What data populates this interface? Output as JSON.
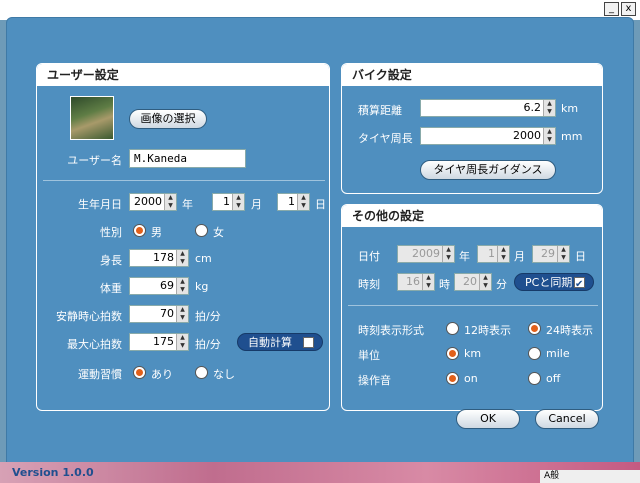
{
  "window": {
    "minimize": "_",
    "close": "x"
  },
  "user_panel": {
    "title": "ユーザー設定",
    "select_image_button": "画像の選択",
    "username_label": "ユーザー名",
    "username_value": "M.Kaneda",
    "birth_label": "生年月日",
    "birth_year": "2000",
    "birth_year_unit": "年",
    "birth_month": "1",
    "birth_month_unit": "月",
    "birth_day": "1",
    "birth_day_unit": "日",
    "gender_label": "性別",
    "gender_male": "男",
    "gender_female": "女",
    "height_label": "身長",
    "height_value": "178",
    "height_unit": "cm",
    "weight_label": "体重",
    "weight_value": "69",
    "weight_unit": "kg",
    "resting_hr_label": "安静時心拍数",
    "resting_hr_value": "70",
    "resting_hr_unit": "拍/分",
    "max_hr_label": "最大心拍数",
    "max_hr_value": "175",
    "max_hr_unit": "拍/分",
    "auto_calc": "自動計算",
    "exercise_label": "運動習慣",
    "exercise_yes": "あり",
    "exercise_no": "なし"
  },
  "bike_panel": {
    "title": "バイク設定",
    "odometer_label": "積算距離",
    "odometer_value": "6.2",
    "odometer_unit": "km",
    "tire_label": "タイヤ周長",
    "tire_value": "2000",
    "tire_unit": "mm",
    "tire_guide_button": "タイヤ周長ガイダンス"
  },
  "other_panel": {
    "title": "その他の設定",
    "date_label": "日付",
    "date_year": "2009",
    "date_year_unit": "年",
    "date_month": "1",
    "date_month_unit": "月",
    "date_day": "29",
    "date_day_unit": "日",
    "time_label": "時刻",
    "time_hour": "16",
    "time_hour_unit": "時",
    "time_min": "20",
    "time_min_unit": "分",
    "pc_sync": "PCと同期",
    "time_format_label": "時刻表示形式",
    "format_12": "12時表示",
    "format_24": "24時表示",
    "unit_label": "単位",
    "unit_km": "km",
    "unit_mile": "mile",
    "sound_label": "操作音",
    "sound_on": "on",
    "sound_off": "off"
  },
  "ok_button": "OK",
  "cancel_button": "Cancel",
  "version": "Version 1.0.0",
  "tray_text": "A般"
}
